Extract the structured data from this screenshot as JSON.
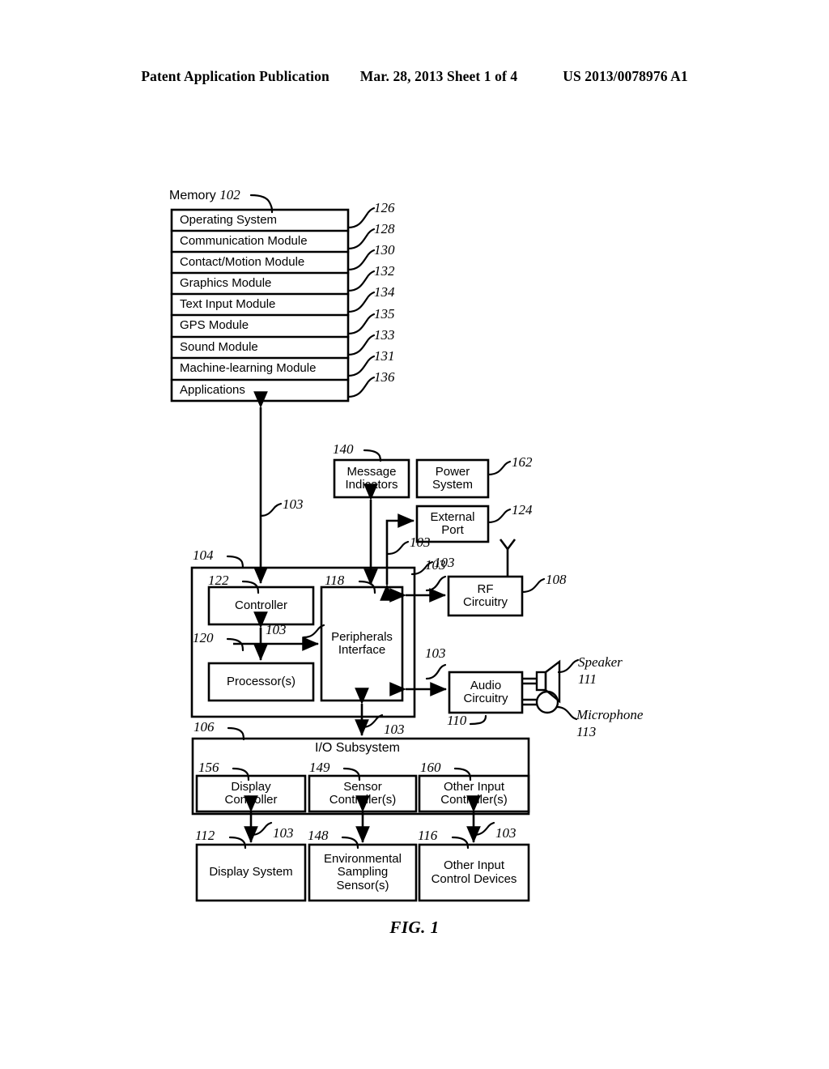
{
  "header": {
    "left": "Patent Application Publication",
    "middle": "Mar. 28, 2013  Sheet 1 of 4",
    "right": "US 2013/0078976 A1"
  },
  "figure": {
    "caption": "FIG. 1",
    "memory_title_text": "Memory",
    "memory_title_ref": "102"
  },
  "memory": {
    "rows": [
      {
        "label": "Operating System",
        "ref": "126"
      },
      {
        "label": "Communication Module",
        "ref": "128"
      },
      {
        "label": "Contact/Motion Module",
        "ref": "130"
      },
      {
        "label": "Graphics Module",
        "ref": "132"
      },
      {
        "label": "Text Input Module",
        "ref": "134"
      },
      {
        "label": "GPS Module",
        "ref": "135"
      },
      {
        "label": "Sound Module",
        "ref": "133"
      },
      {
        "label": "Machine-learning Module",
        "ref": "131"
      },
      {
        "label": "Applications",
        "ref": "136"
      }
    ]
  },
  "blocks": {
    "message_indicators": {
      "label": "Message\nIndicators",
      "ref": "140"
    },
    "power_system": {
      "label": "Power\nSystem",
      "ref": "162"
    },
    "external_port": {
      "label": "External\nPort",
      "ref": "124"
    },
    "rf_circuitry": {
      "label": "RF\nCircuitry",
      "ref": "108"
    },
    "audio_circuitry": {
      "label": "Audio\nCircuitry",
      "ref": "110"
    },
    "controller": {
      "label": "Controller",
      "ref": "122"
    },
    "processors": {
      "label": "Processor(s)",
      "ref": "120"
    },
    "peripherals_interface": {
      "label": "Peripherals\nInterface",
      "ref": "118"
    },
    "device_container": {
      "ref": "104"
    },
    "io_subsystem": {
      "label": "I/O Subsystem",
      "ref": "106"
    },
    "display_controller": {
      "label": "Display\nController",
      "ref": "156"
    },
    "sensor_controller": {
      "label": "Sensor\nController(s)",
      "ref": "149"
    },
    "other_input_controller": {
      "label": "Other Input\nController(s)",
      "ref": "160"
    },
    "display_system": {
      "label": "Display System",
      "ref": "112"
    },
    "environmental_sensor": {
      "label": "Environmental\nSampling\nSensor(s)",
      "ref": "148"
    },
    "other_input_devices": {
      "label": "Other Input\nControl Devices",
      "ref": "116"
    }
  },
  "peripherals": {
    "speaker": {
      "label": "Speaker",
      "ref": "111"
    },
    "microphone": {
      "label": "Microphone",
      "ref": "113"
    }
  },
  "bus_labels": {
    "memory_bus": "103",
    "msg_bus": "103",
    "ext_port_bus": "103",
    "rf_bus": "103",
    "cpu_bus": "103",
    "audio_bus": "103",
    "io_bus": "103",
    "display_bus": "103",
    "other_input_bus": "103"
  },
  "colors": {
    "stroke": "#000000",
    "background": "#ffffff"
  }
}
